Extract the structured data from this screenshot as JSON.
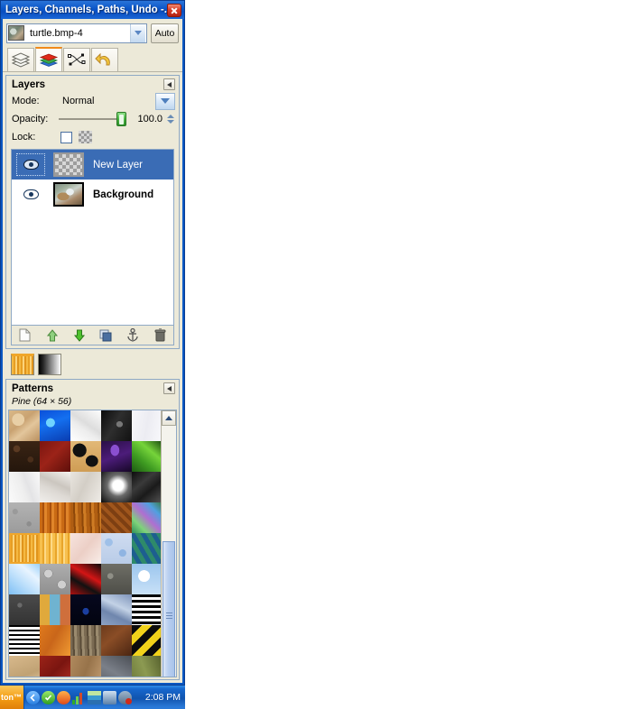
{
  "window": {
    "title": "Layers, Channels, Paths, Undo -...",
    "close_icon": "close-icon"
  },
  "image_selector": {
    "image_name": "turtle.bmp-4",
    "dropdown_icon": "chevron-down-icon",
    "auto_label": "Auto",
    "thumb_icon": "image-thumbnail"
  },
  "tabs": [
    {
      "name": "layers",
      "icon": "layers-stack-icon",
      "active": false
    },
    {
      "name": "channels",
      "icon": "channels-icon",
      "active": true
    },
    {
      "name": "paths",
      "icon": "paths-node-icon",
      "active": false
    },
    {
      "name": "undo-history",
      "icon": "undo-arrow-icon",
      "active": false
    }
  ],
  "layers_panel": {
    "title": "Layers",
    "menu_icon": "panel-menu-arrow-icon",
    "mode_label": "Mode:",
    "mode_value": "Normal",
    "opacity_label": "Opacity:",
    "opacity_value": "100.0",
    "lock_label": "Lock:",
    "lock_pixels_checked": false,
    "lock_alpha_icon": "checkerboard-alpha-icon",
    "layers": [
      {
        "name": "New Layer",
        "visible": true,
        "selected": true,
        "thumb": "transparent-checker",
        "eye_icon": "eye-icon"
      },
      {
        "name": "Background",
        "visible": true,
        "selected": false,
        "thumb": "turtle-photo",
        "eye_icon": "eye-icon"
      }
    ],
    "buttons": [
      {
        "name": "new-layer",
        "icon": "new-page-icon"
      },
      {
        "name": "raise-layer",
        "icon": "raise-up-icon"
      },
      {
        "name": "lower-layer",
        "icon": "lower-down-icon"
      },
      {
        "name": "duplicate-layer",
        "icon": "duplicate-icon"
      },
      {
        "name": "anchor-layer",
        "icon": "anchor-icon"
      },
      {
        "name": "delete-layer",
        "icon": "trash-icon"
      }
    ]
  },
  "indicator_row": {
    "pattern_swatch": "pine-pattern",
    "gradient_swatch": "black-to-white-gradient"
  },
  "patterns_panel": {
    "title": "Patterns",
    "menu_icon": "panel-menu-arrow-icon",
    "selected_pattern": "Pine (64 × 56)",
    "scroll_up_icon": "scroll-up-arrow-icon",
    "swatches": [
      {
        "name": "dried-mud",
        "css": "radial-gradient(circle at 30% 30%,#e8cfa6 0 20%,transparent 21%),linear-gradient(140deg,#d9b887 0%,#c9a271 40%,#e3c69c 60%,#b98f5e 100%)"
      },
      {
        "name": "blue-water",
        "css": "radial-gradient(circle at 35% 40%,#6fd4ff 0 16%,transparent 17%),linear-gradient(160deg,#0b4fd8 0%,#1470f0 40%,#0a3cb0 100%)"
      },
      {
        "name": "marble-white",
        "css": "linear-gradient(35deg,#ffffff 0%,#ededed 40%,#dddddd 55%,#fdfdfd 100%)"
      },
      {
        "name": "dark-smoke",
        "css": "radial-gradient(ellipse at 60% 45%,#777 0 12%,transparent 13%),linear-gradient(120deg,#0b0b0b 0%,#2e2e2e 45%,#111 100%)"
      },
      {
        "name": "paper-white",
        "css": "linear-gradient(100deg,#f7f7fa 0%,#ececf2 50%,#f9f9fc 100%)"
      },
      {
        "name": "coffee-beans",
        "css": "radial-gradient(circle at 25% 25%,#5b3a22 0 10%,transparent 11%),radial-gradient(circle at 70% 60%,#4a2e1a 0 10%,transparent 11%),linear-gradient(#3a2414,#24160c)"
      },
      {
        "name": "red-leather",
        "css": "linear-gradient(135deg,#7a1510 0%,#9c2318 45%,#5e0f0a 100%)"
      },
      {
        "name": "leopard",
        "css": "radial-gradient(ellipse at 30% 30%,#111 0 22%,transparent 23%),radial-gradient(ellipse at 70% 65%,#111 0 20%,transparent 21%),linear-gradient(#e2b877,#cf9d55)"
      },
      {
        "name": "purple-velvet",
        "css": "radial-gradient(ellipse at 45% 30%,#8a4fd0 0 18%,transparent 19%),linear-gradient(160deg,#2a0f46 0%,#4c1c7a 50%,#160726 100%)"
      },
      {
        "name": "green-leaves",
        "css": "linear-gradient(40deg,#1d5a12 0%,#3f9c22 35%,#76d43a 65%,#1a4a10 100%)"
      },
      {
        "name": "white-marble-2",
        "css": "linear-gradient(70deg,#fbfbfb 0%,#eeeeee 45%,#e4e4e6 60%,#fafafa 100%)"
      },
      {
        "name": "grey-marble",
        "css": "linear-gradient(25deg,#f1efec 0%,#ddd9d4 40%,#cbc6bf 60%,#f4f2ef 100%)"
      },
      {
        "name": "stone-light",
        "css": "linear-gradient(115deg,#e9e5df 0%,#d3cec6 45%,#efece7 100%)"
      },
      {
        "name": "black-white-blur",
        "css": "radial-gradient(ellipse at 55% 45%,#ffffff 0 22%,#6a6a6a 45%,#0a0a0a 100%)"
      },
      {
        "name": "dark-marble",
        "css": "linear-gradient(140deg,#0d0d0d 0%,#3a3a3a 35%,#1a1a1a 60%,#555 100%)"
      },
      {
        "name": "concrete",
        "css": "radial-gradient(circle at 20% 30%,#9a9a9a 0 8%,transparent 9%),radial-gradient(circle at 65% 70%,#8d8d8d 0 8%,transparent 9%),linear-gradient(#b3b3b3,#9b9b9b)"
      },
      {
        "name": "orange-wood",
        "css": "repeating-linear-gradient(90deg,#c96a14 0 3px,#a9500c 3px 5px,#e0852a 5px 8px)"
      },
      {
        "name": "wood-planks",
        "css": "repeating-linear-gradient(88deg,#b05e12 0 4px,#8d4709 4px 6px,#cf7c24 6px 9px)"
      },
      {
        "name": "parquet",
        "css": "repeating-linear-gradient(45deg,#7d3f12 0 4px,#a0561c 4px 8px),repeating-linear-gradient(-45deg,#6a3210 0 4px,transparent 4px 8px)"
      },
      {
        "name": "rainbow-noise",
        "css": "linear-gradient(45deg,#2f8f5a 0%,#7fd37a 25%,#b06fd0 50%,#50a0e0 75%,#3a7a40 100%)"
      },
      {
        "name": "pine",
        "css": "repeating-linear-gradient(90deg,#f5b942 0 2px,#e79f24 2px 4px,#fcd37a 4px 6px,#e0941c 6px 8px)",
        "selected": true
      },
      {
        "name": "pine-2",
        "css": "repeating-linear-gradient(90deg,#f7c04e 0 3px,#e8a52a 3px 5px,#fdd985 5px 7px)"
      },
      {
        "name": "pink-skin",
        "css": "linear-gradient(130deg,#f7e4de 0%,#eccfc6 50%,#f9eee9 100%)"
      },
      {
        "name": "blue-bubbles",
        "css": "radial-gradient(circle at 25% 30%,#9fc0e8 0 12%,transparent 13%),radial-gradient(circle at 70% 65%,#8fb4e2 0 12%,transparent 13%),linear-gradient(#cfdcf0,#b9cce8)"
      },
      {
        "name": "cubes-3d",
        "css": "repeating-linear-gradient(60deg,#2e8a6a 0 5px,#1d5f8f 5px 10px),repeating-linear-gradient(-60deg,#6a3f8a 0 5px,transparent 5px 10px)"
      },
      {
        "name": "sky-blue",
        "css": "linear-gradient(40deg,#7fc0f5 0%,#bcdffb 40%,#e8f4ff 70%,#9ad0f8 100%)"
      },
      {
        "name": "bubbles-grey",
        "css": "radial-gradient(circle at 28% 32%,#d0d0d0 0 13%,#7a7a7a 14%,transparent 15%),radial-gradient(circle at 72% 68%,#cfcfcf 0 13%,#787878 14%,transparent 15%),linear-gradient(#aeaeae,#8f8f8f)"
      },
      {
        "name": "red-black-zigzag",
        "css": "linear-gradient(30deg,#b00f0f 0%,#111 35%,#d41515 60%,#0a0a0a 100%)"
      },
      {
        "name": "gravel",
        "css": "radial-gradient(circle at 30% 40%,#8f8f86 0 10%,transparent 11%),linear-gradient(#6e6e66,#4e4e48)"
      },
      {
        "name": "sky-clouds",
        "css": "radial-gradient(ellipse at 40% 40%,#ffffff 0 22%,transparent 23%),linear-gradient(#9cc6ee,#c9e1f7)"
      },
      {
        "name": "dark-sand",
        "css": "radial-gradient(circle at 35% 35%,#6a6a6a 0 8%,transparent 9%),linear-gradient(#4b4b4b,#333)"
      },
      {
        "name": "color-blocks",
        "css": "linear-gradient(90deg,#e0a93c 0 33%,#6fb3d0 33% 66%,#cf6f3c 66% 100%)"
      },
      {
        "name": "dark-blue-void",
        "css": "radial-gradient(ellipse at 50% 55%,#1b3fa0 0 14%,transparent 15%),linear-gradient(#06081e,#020410)"
      },
      {
        "name": "cracked-stone",
        "css": "linear-gradient(25deg,#8ea3c4 0%,#6f86ad 35%,#c3d2e6 60%,#7d93ba 100%)"
      },
      {
        "name": "stripes-h",
        "css": "repeating-linear-gradient(180deg,#000 0 3px,#fff 3px 6px)"
      },
      {
        "name": "stripes-h-2",
        "css": "repeating-linear-gradient(180deg,#000 0 2px,#fff 2px 5px)"
      },
      {
        "name": "orange-crack",
        "css": "linear-gradient(120deg,#e07a1c 0%,#c9661a 45%,#f09a32 100%)"
      },
      {
        "name": "tree-bark",
        "css": "repeating-linear-gradient(88deg,#7a6a52 0 3px,#5a4c38 3px 5px,#9a8a6e 5px 8px)"
      },
      {
        "name": "brown-fur",
        "css": "linear-gradient(140deg,#6b3a1c 0%,#8a4d26 40%,#4a2512 100%)"
      },
      {
        "name": "hazard-stripes",
        "css": "repeating-linear-gradient(-45deg,#f2d21a 0 8px,#0c0c0c 8px 16px)"
      },
      {
        "name": "sand-edge",
        "css": "linear-gradient(160deg,#d8b98c 0%,#c0a274 60%,#e4cba6 100%)"
      },
      {
        "name": "red-cloth",
        "css": "linear-gradient(135deg,#9c2318 0%,#7a1510 50%,#b33225 100%)"
      },
      {
        "name": "brown-paper",
        "css": "linear-gradient(110deg,#b08a5e 0%,#97734a 50%,#c29d72 100%)"
      },
      {
        "name": "slate-grey",
        "css": "linear-gradient(30deg,#5d6168 0%,#7b8089 45%,#4a4e55 100%)"
      },
      {
        "name": "olive-mix",
        "css": "linear-gradient(70deg,#6e7a3c 0%,#8c9a52 45%,#545e2c 100%)"
      }
    ]
  },
  "taskbar": {
    "start_label": "ton™",
    "time": "2:08 PM",
    "tray_icons": [
      "back-arrow-icon",
      "shield-check-icon",
      "sync-icon",
      "signal-bars-icon",
      "stack-icon",
      "network-icon",
      "volume-mute-icon"
    ]
  }
}
